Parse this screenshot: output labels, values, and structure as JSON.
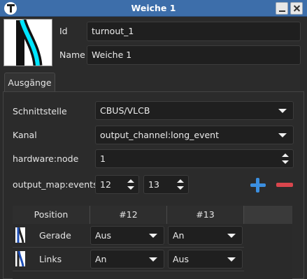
{
  "window": {
    "title": "Weiche 1"
  },
  "header": {
    "id_label": "Id",
    "id_value": "turnout_1",
    "name_label": "Name",
    "name_value": "Weiche 1"
  },
  "tabs": [
    {
      "label": "Ausgänge"
    }
  ],
  "form": {
    "interface_label": "Schnittstelle",
    "interface_value": "CBUS/VLCB",
    "channel_label": "Kanal",
    "channel_value": "output_channel:long_event",
    "node_label": "hardware:node",
    "node_value": "1",
    "events_label": "output_map:events",
    "event_values": [
      "12",
      "13"
    ]
  },
  "output_map": {
    "columns": [
      "Position",
      "#12",
      "#13"
    ],
    "rows": [
      {
        "position": "Gerade",
        "values": [
          "Aus",
          "An"
        ],
        "icon": "turnout-straight-icon"
      },
      {
        "position": "Links",
        "values": [
          "An",
          "Aus"
        ],
        "icon": "turnout-left-icon"
      }
    ]
  },
  "colors": {
    "titlebar": "#3d6eaa",
    "accent_cyan": "#00e5ff",
    "add": "#3b8fe0",
    "remove": "#d9464d"
  }
}
